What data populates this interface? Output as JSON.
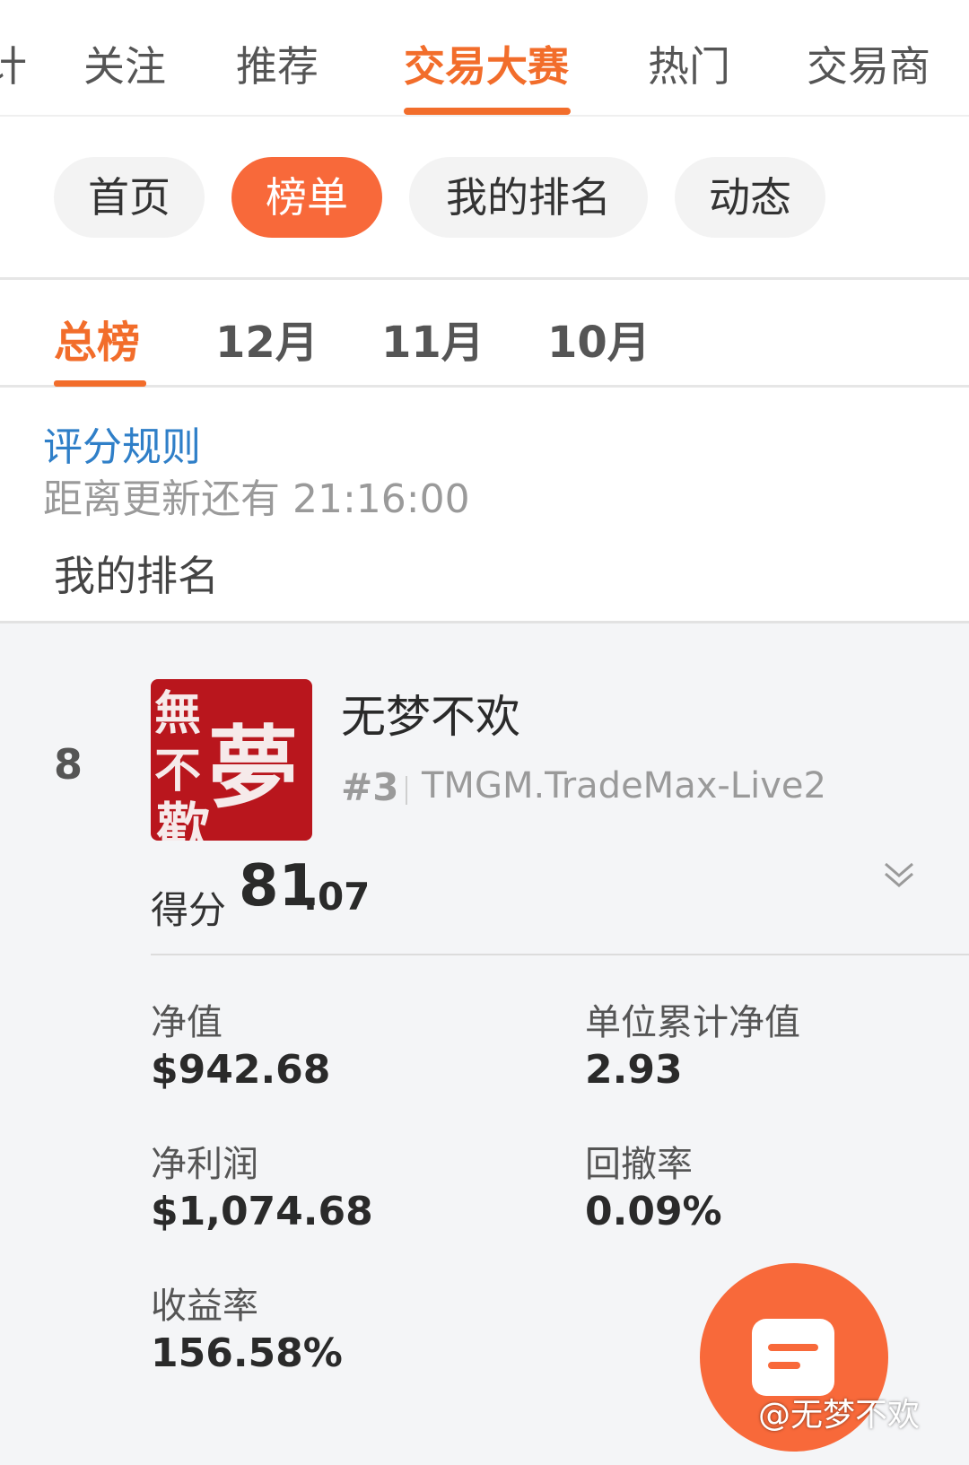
{
  "top_tabs": [
    {
      "label": "计"
    },
    {
      "label": "关注"
    },
    {
      "label": "推荐"
    },
    {
      "label": "交易大赛"
    },
    {
      "label": "热门"
    },
    {
      "label": "交易商"
    }
  ],
  "pills": [
    {
      "label": "首页"
    },
    {
      "label": "榜单"
    },
    {
      "label": "我的排名"
    },
    {
      "label": "动态"
    }
  ],
  "months": [
    {
      "label": "总榜"
    },
    {
      "label": "12月"
    },
    {
      "label": "11月"
    },
    {
      "label": "10月"
    }
  ],
  "info": {
    "rules_link": "评分规则",
    "countdown": "距离更新还有 21:16:00",
    "my_rank_label": "我的排名"
  },
  "entry": {
    "rank": "8",
    "avatar_chars": [
      "無",
      "夢",
      "不",
      "歡"
    ],
    "username": "无梦不欢",
    "rank_tag": "#3",
    "account": "TMGM.TradeMax-Live2",
    "score_label": "得分",
    "score_int": "81",
    "score_dec": ".07",
    "metrics": [
      {
        "label": "净值",
        "value": "$942.68"
      },
      {
        "label": "单位累计净值",
        "value": "2.93"
      },
      {
        "label": "净利润",
        "value": "$1,074.68"
      },
      {
        "label": "回撤率",
        "value": "0.09%"
      },
      {
        "label": "收益率",
        "value": "156.58%"
      }
    ]
  },
  "watermark": "@无梦不欢",
  "colors": {
    "accent": "#f26d2b",
    "pill_active": "#f8693a",
    "link": "#2f7fc8",
    "avatar": "#b9161d"
  },
  "icons": {
    "chevron": "double-chevron-down-icon",
    "fab": "chat-document-icon"
  }
}
